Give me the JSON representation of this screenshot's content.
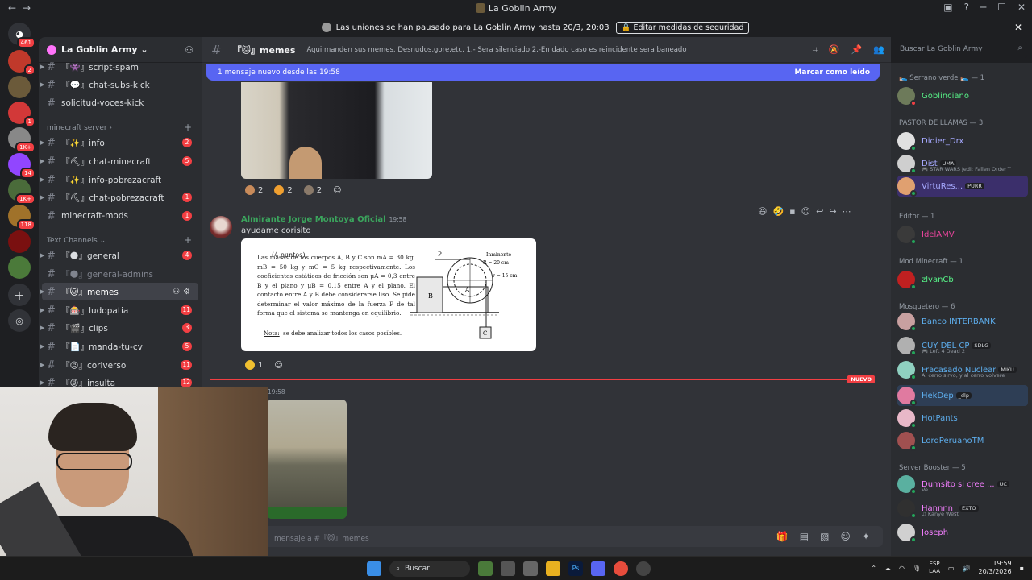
{
  "window": {
    "title": "La Goblin Army"
  },
  "notice": {
    "text": "Las uniones se han pausado para La Goblin Army hasta 20/3, 20:03",
    "button": "Editar medidas de seguridad"
  },
  "server": {
    "name": "La Goblin Army"
  },
  "rail": {
    "badges": [
      "461",
      "2",
      "1",
      "1K+",
      "14",
      "1K+",
      "118"
    ]
  },
  "channels": [
    {
      "label": "『👾』script-spam",
      "badge": ""
    },
    {
      "label": "『💬』chat-subs-kick",
      "badge": ""
    },
    {
      "label": "solicitud-voces-kick",
      "badge": ""
    }
  ],
  "cat_minecraft": "minecraft server",
  "mc_channels": [
    {
      "label": "『✨』info",
      "badge": "2"
    },
    {
      "label": "『⛏』chat-minecraft",
      "badge": "5"
    },
    {
      "label": "『✨』info-pobrezacraft",
      "badge": ""
    },
    {
      "label": "『⛏』chat-pobrezacraft",
      "badge": "1"
    },
    {
      "label": "minecraft-mods",
      "badge": "1"
    }
  ],
  "cat_text": "Text Channels",
  "text_channels": [
    {
      "label": "『🌑』general",
      "badge": "4"
    },
    {
      "label": "『🌑』general-admins",
      "badge": ""
    },
    {
      "label": "『🐱』memes",
      "badge": ""
    },
    {
      "label": "『🎰』ludopatia",
      "badge": "11"
    },
    {
      "label": "『🎬』clips",
      "badge": "3"
    },
    {
      "label": "『📄』manda-tu-cv",
      "badge": "5"
    },
    {
      "label": "『😡』coriverso",
      "badge": "11"
    },
    {
      "label": "『😡』insulta",
      "badge": "12"
    }
  ],
  "header": {
    "channel": "『🐱』memes",
    "topic": "Aqui manden sus memes. Desnudos,gore,etc. 1.- Sera silenciado 2.-En dado caso es reincidente sera baneado",
    "search": "Buscar La Goblin Army"
  },
  "newbar": {
    "text": "1 mensaje nuevo desde las 19:58",
    "mark": "Marcar como leído"
  },
  "reactions1": [
    "2",
    "2",
    "2"
  ],
  "message": {
    "author": "Almirante Jorge Montoya Oficial",
    "time": "19:58",
    "text": "ayudame corisito",
    "reaction": "1"
  },
  "doc": {
    "points": "(4 puntos)",
    "problem": "Las masas de los cuerpos A, B y C son mA = 30 kg, mB = 50 kg y mC = 5 kg respectivamente. Los coeficientes estáticos de fricción son μA = 0,3 entre B y el plano y μB = 0,15 entre A y el plano. El contacto entre A y B debe considerarse liso. Se pide determinar el valor máximo de la fuerza P de tal forma que el sistema se mantenga en equilibrio.",
    "nota_label": "Nota:",
    "nota": "se debe analizar todos los casos posibles.",
    "fig_p": "P",
    "fig_r": "R = 20 cm",
    "fig_r2": "r = 15 cm",
    "fig_a": "A",
    "fig_b": "B",
    "fig_c": "C",
    "fig_note": "Inminente"
  },
  "nuevo": "NUEVO",
  "msg2_time": "19:58",
  "composer": {
    "placeholder": "mensaje a #『🐱』memes"
  },
  "members": {
    "groups": [
      "🛌 Serrano verde 🛌 — 1",
      "PASTOR DE LLAMAS — 3",
      "Editor — 1",
      "Mod Minecraft — 1",
      "Mosquetero — 6",
      "Server Booster — 5"
    ],
    "list": [
      {
        "name": "Goblinciano",
        "color": "#57f287",
        "sub": "",
        "tag": ""
      },
      {
        "name": "Didier_Drx",
        "color": "#a6a9ff",
        "sub": "",
        "tag": ""
      },
      {
        "name": "Dist",
        "color": "#a6a9ff",
        "sub": "🎮 STAR WARS Jedi: Fallen Order™",
        "tag": "UMA"
      },
      {
        "name": "VirtuRes...",
        "color": "#a6a9ff",
        "sub": "",
        "tag": "PURR"
      },
      {
        "name": "IdelAMV",
        "color": "#eb459e",
        "sub": "",
        "tag": ""
      },
      {
        "name": "zlvanCb",
        "color": "#57f287",
        "sub": "",
        "tag": ""
      },
      {
        "name": "Banco INTERBANK",
        "color": "#5dadec",
        "sub": "",
        "tag": ""
      },
      {
        "name": "CUY DEL CP",
        "color": "#5dadec",
        "sub": "🎮 Left 4 Dead 2",
        "tag": "SDLG"
      },
      {
        "name": "Fracasado Nuclear",
        "color": "#5dadec",
        "sub": "Al cerro sirvo, y al cerro volvere",
        "tag": "MIKU"
      },
      {
        "name": "HekDep",
        "color": "#5dadec",
        "sub": "",
        "tag": "_dlp"
      },
      {
        "name": "HotPants",
        "color": "#5dadec",
        "sub": "",
        "tag": ""
      },
      {
        "name": "LordPeruanoTM",
        "color": "#5dadec",
        "sub": "",
        "tag": ""
      },
      {
        "name": "Dumsito si cree ...",
        "color": "#f47fff",
        "sub": "Ve",
        "tag": "UC"
      },
      {
        "name": "Hannnn_",
        "color": "#f47fff",
        "sub": "♫ Kanye West",
        "tag": "EXTO"
      },
      {
        "name": "Joseph",
        "color": "#f47fff",
        "sub": "",
        "tag": ""
      }
    ]
  },
  "taskbar": {
    "search": "Buscar",
    "lang1": "ESP",
    "lang2": "LAA",
    "time": "19:59",
    "date": "20/3/2026"
  },
  "colors": {
    "blurple": "#5865f2",
    "danger": "#f23f43",
    "online": "#23a55a"
  }
}
